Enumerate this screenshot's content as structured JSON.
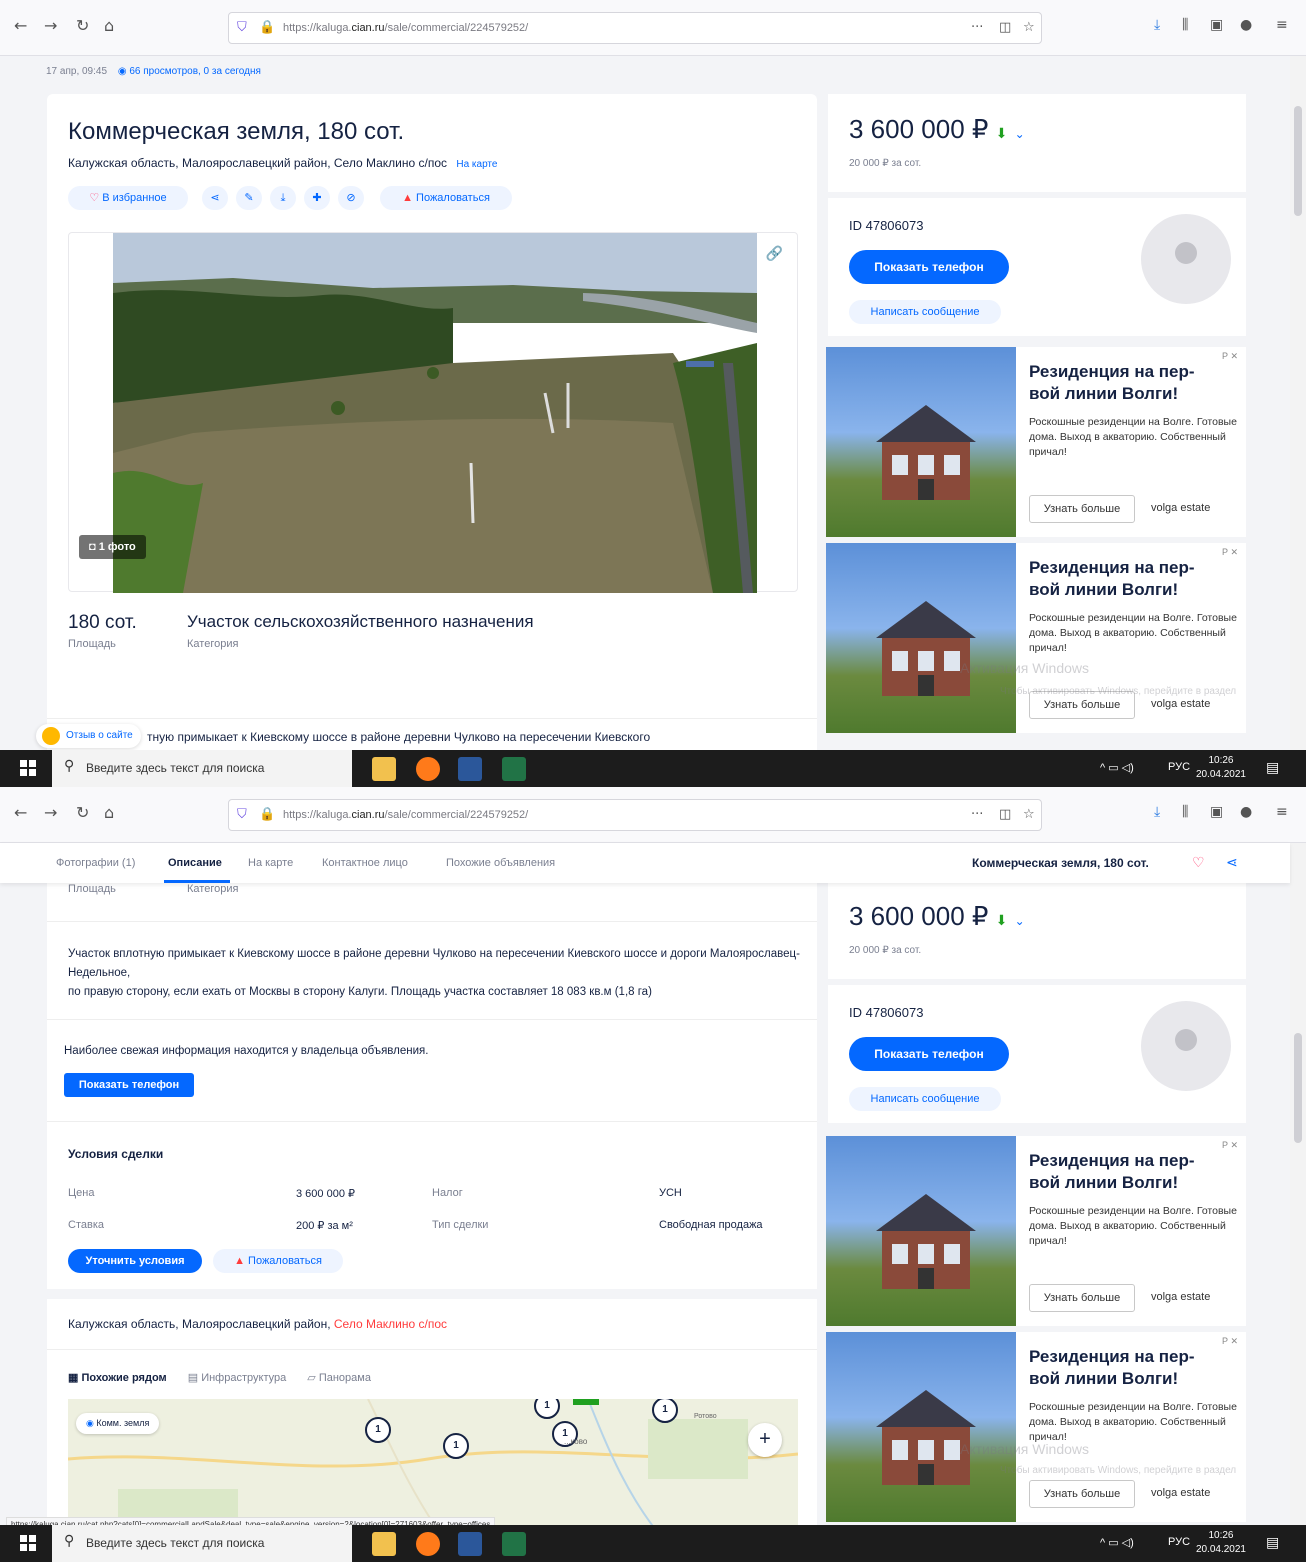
{
  "browser": {
    "url_prefix": "https://kaluga.",
    "url_domain": "cian.ru",
    "url_path": "/sale/commercial/224579252/",
    "status_url": "https://kaluga.cian.ru/cat.php?cats[0]=commercialLandSale&deal_type=sale&engine_version=2&location[0]=271603&offer_type=offices"
  },
  "taskbar": {
    "search_placeholder": "Введите здесь текст для поиска",
    "lang": "РУС",
    "time": "10:26",
    "date": "20.04.2021"
  },
  "meta": {
    "date": "17 апр, 09:45",
    "views": "66 просмотров, 0 за сегодня"
  },
  "listing": {
    "title": "Коммерческая земля, 180 сот.",
    "address": "Калужская область, Малоярославецкий район, Село Маклино с/пос",
    "map_link": "На карте",
    "favorite": "В избранное",
    "report": "Пожаловаться",
    "photo_count": "1 фото",
    "area_value": "180 сот.",
    "area_label": "Площадь",
    "category_value": "Участок сельскохозяйственного назначения",
    "category_label": "Категория",
    "desc_peek": "тную примыкает к Киевскому шоссе в районе деревни Чулково на пересечении Киевского",
    "feedback": "Отзыв о сайте"
  },
  "sidebar": {
    "price": "3 600 000 ₽",
    "price_per": "20 000 ₽ за сот.",
    "id": "ID 47806073",
    "show_phone": "Показать телефон",
    "write_message": "Написать сообщение"
  },
  "ad": {
    "title": "Резиденция на пер-вой линии Волги!",
    "text": "Роскошные резиденции на Волге. Готовые дома. Выход в акваторию. Собственный причал!",
    "more": "Узнать больше",
    "brand": "volga estate",
    "mark": "Р ✕"
  },
  "tabs": [
    {
      "label": "Фотографии (1)"
    },
    {
      "label": "Описание"
    },
    {
      "label": "На карте"
    },
    {
      "label": "Контактное лицо"
    },
    {
      "label": "Похожие объявления"
    }
  ],
  "sticky_title": "Коммерческая земля, 180 сот.",
  "description": {
    "text1": "Участок вплотную примыкает к Киевскому шоссе в районе деревни Чулково на пересечении Киевского шоссе и дороги Малоярославец-Недельное,",
    "text2": "по правую сторону, если ехать от Москвы в сторону Калуги. Площадь участка составляет 18 083 кв.м (1,8 га)",
    "fresh_info": "Наиболее свежая информация находится у владельца объявления.",
    "show_phone": "Показать телефон"
  },
  "deal": {
    "heading": "Условия сделки",
    "rows": [
      {
        "k1": "Цена",
        "v1": "3 600 000 ₽",
        "k2": "Налог",
        "v2": "УСН"
      },
      {
        "k1": "Ставка",
        "v1": "200 ₽ за м²",
        "k2": "Тип сделки",
        "v2": "Свободная продажа"
      }
    ],
    "clarify": "Уточнить условия",
    "report": "Пожаловаться"
  },
  "location": {
    "address_plain": "Калужская область, Малоярославецкий район, ",
    "address_link": "Село Маклино с/пос",
    "map_tabs": [
      "Похожие рядом",
      "Инфраструктура",
      "Панорама"
    ],
    "map_chip": "Комм. земля",
    "map_label_a": "...ково",
    "map_label_b": "Ротово"
  },
  "windows_watermark": {
    "line1": "Активация Windows",
    "line2": "Чтобы активировать Windows, перейдите в раздел"
  }
}
